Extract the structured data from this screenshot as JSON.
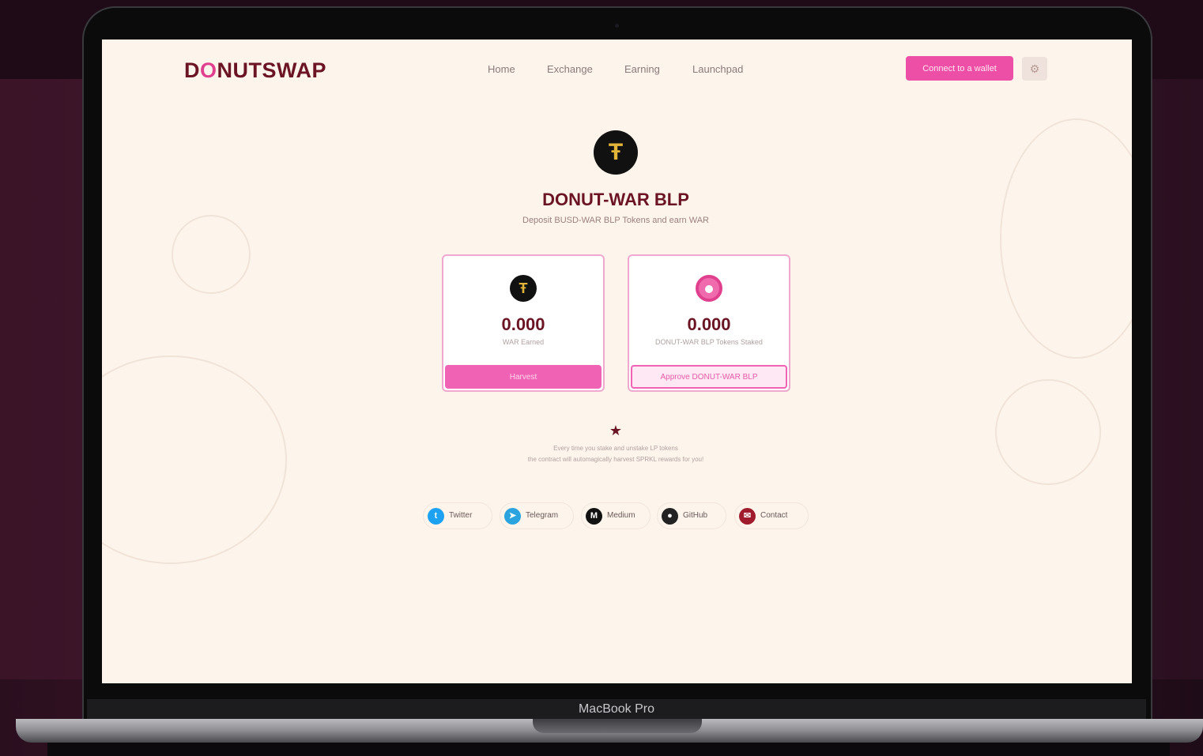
{
  "app": {
    "logo_text": "DONUTSWAP",
    "logo_prefix": "D",
    "logo_o": "O",
    "logo_suffix": "NUTSWAP",
    "brand_colors": {
      "primary": "#6b1424",
      "accent": "#ee4fa6"
    }
  },
  "nav": [
    {
      "label": "Home"
    },
    {
      "label": "Exchange"
    },
    {
      "label": "Earning"
    },
    {
      "label": "Launchpad"
    }
  ],
  "header": {
    "connect_label": "Connect to a wallet",
    "settings_icon": "gear-icon"
  },
  "hero": {
    "icon": "war-token-icon",
    "title": "DONUT-WAR BLP",
    "subtitle": "Deposit BUSD-WAR BLP Tokens and earn WAR"
  },
  "cards": [
    {
      "icon": "war-token-icon",
      "value": "0.000",
      "label": "WAR Earned",
      "button": "Harvest"
    },
    {
      "icon": "donut-icon",
      "value": "0.000",
      "label": "DONUT-WAR BLP Tokens Staked",
      "button": "Approve DONUT-WAR BLP"
    }
  ],
  "note": {
    "line1": "Every time you stake and unstake LP tokens",
    "line2": "the contract will automagically harvest SPRKL rewards for you!"
  },
  "socials": [
    {
      "label": "Twitter",
      "icon": "twitter-icon",
      "color": "#1da1f2"
    },
    {
      "label": "Telegram",
      "icon": "telegram-icon",
      "color": "#2aa3df"
    },
    {
      "label": "Medium",
      "icon": "medium-icon",
      "color": "#111111"
    },
    {
      "label": "GitHub",
      "icon": "github-icon",
      "color": "#222222"
    },
    {
      "label": "Contact",
      "icon": "contact-icon",
      "color": "#a01c2c"
    }
  ],
  "device": {
    "model_label": "MacBook Pro"
  }
}
